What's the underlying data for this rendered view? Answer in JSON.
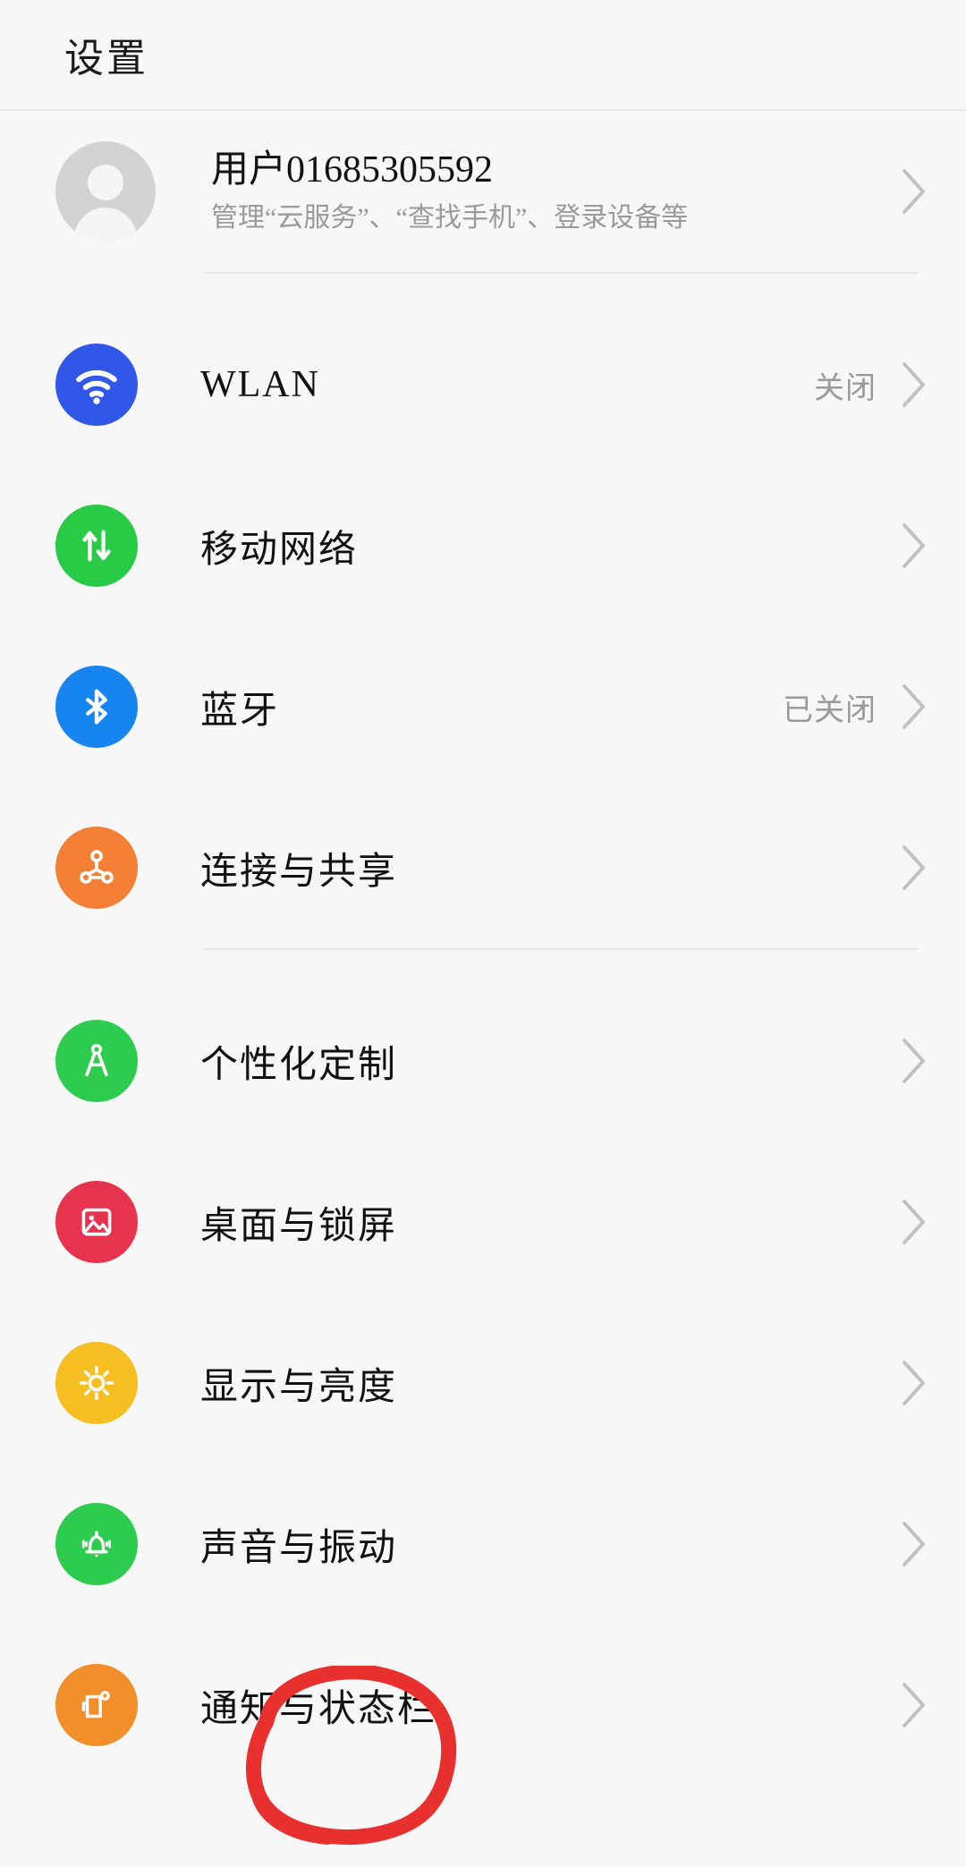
{
  "header": {
    "title": "设置"
  },
  "account": {
    "name": "用户01685305592",
    "subtitle": "管理“云服务”、“查找手机”、登录设备等",
    "avatar_icon": "person-avatar-icon",
    "chevron_icon": "chevron-right-icon"
  },
  "groups": [
    {
      "id": "connectivity",
      "items": [
        {
          "label": "WLAN",
          "value": "关闭",
          "icon": "wifi-icon",
          "color": "#3157E8"
        },
        {
          "label": "移动网络",
          "value": "",
          "icon": "mobile-data-arrows-icon",
          "color": "#27CB46"
        },
        {
          "label": "蓝牙",
          "value": "已关闭",
          "icon": "bluetooth-icon",
          "color": "#1685F0"
        },
        {
          "label": "连接与共享",
          "value": "",
          "icon": "share-nodes-icon",
          "color": "#F38034"
        }
      ]
    },
    {
      "id": "personalization",
      "items": [
        {
          "label": "个性化定制",
          "value": "",
          "icon": "compass-drafting-icon",
          "color": "#2ECC4E"
        },
        {
          "label": "桌面与锁屏",
          "value": "",
          "icon": "wallpaper-image-icon",
          "color": "#E8334F"
        },
        {
          "label": "显示与亮度",
          "value": "",
          "icon": "brightness-sun-icon",
          "color": "#F6BE21"
        },
        {
          "label": "声音与振动",
          "value": "",
          "icon": "bell-vibration-icon",
          "color": "#2ECC4E"
        },
        {
          "label": "通知与状态栏",
          "value": "",
          "icon": "notification-badge-icon",
          "color": "#F38F2A"
        }
      ]
    }
  ],
  "annotation": {
    "shape": "hand-drawn-red-circle",
    "color": "#E8312F",
    "targets": "通知与状态栏"
  }
}
